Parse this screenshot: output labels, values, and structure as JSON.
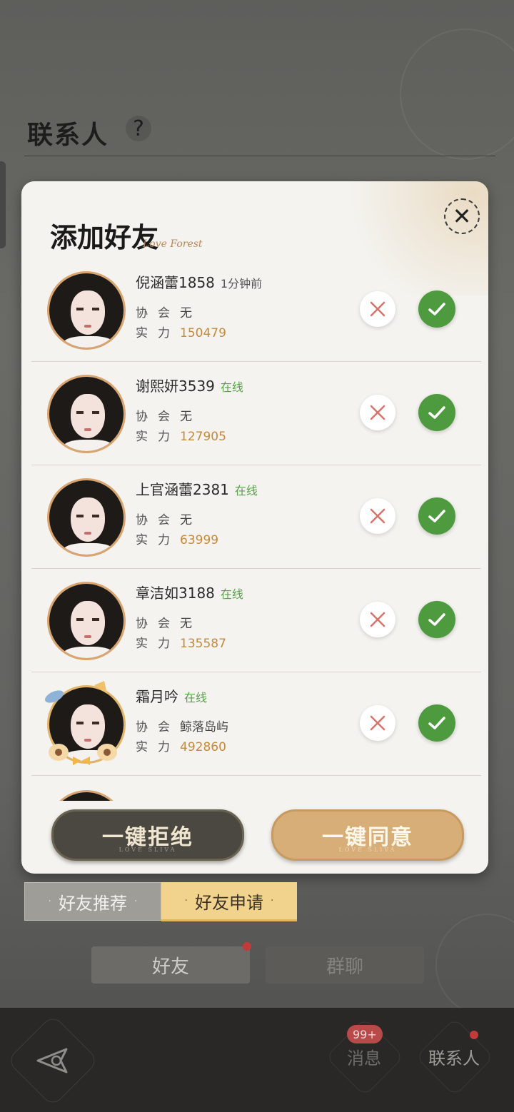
{
  "header": {
    "title": "联系人",
    "help_symbol": "?"
  },
  "modal": {
    "title": "添加好友",
    "title_script": "Love Forest",
    "close_symbol": "✕",
    "requests": [
      {
        "name": "倪涵蕾1858",
        "status": "1分钟前",
        "status_type": "time",
        "assoc_label": "协会",
        "assoc": "无",
        "power_label": "实力",
        "power": "150479"
      },
      {
        "name": "谢熙妍3539",
        "status": "在线",
        "status_type": "online",
        "assoc_label": "协会",
        "assoc": "无",
        "power_label": "实力",
        "power": "127905"
      },
      {
        "name": "上官涵蕾2381",
        "status": "在线",
        "status_type": "online",
        "assoc_label": "协会",
        "assoc": "无",
        "power_label": "实力",
        "power": "63999"
      },
      {
        "name": "章洁如3188",
        "status": "在线",
        "status_type": "online",
        "assoc_label": "协会",
        "assoc": "无",
        "power_label": "实力",
        "power": "135587"
      },
      {
        "name": "霜月吟",
        "status": "在线",
        "status_type": "online",
        "assoc_label": "协会",
        "assoc": "鲸落岛屿",
        "power_label": "实力",
        "power": "492860"
      }
    ],
    "reject_all_label": "一键拒绝",
    "accept_all_label": "一键同意",
    "button_sub": "LOVE SLIVA"
  },
  "tabs": {
    "recommend": "好友推荐",
    "requests": "好友申请",
    "dot": "·"
  },
  "segments": {
    "friends": "好友",
    "groups": "群聊"
  },
  "bottom_nav": {
    "messages": "消息",
    "messages_badge": "99+",
    "contacts": "联系人"
  },
  "colors": {
    "accept": "#4e9a3f",
    "online": "#58a04a",
    "power": "#c58a3a",
    "accent_tab": "#f2d38e"
  }
}
